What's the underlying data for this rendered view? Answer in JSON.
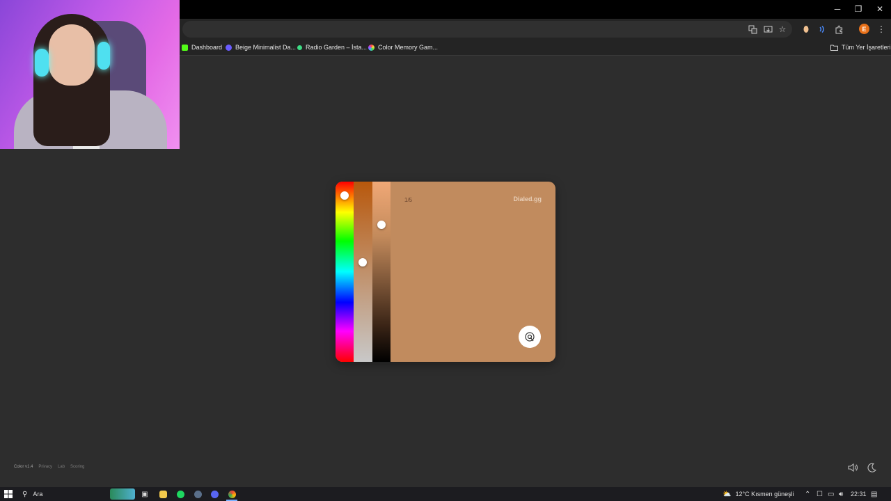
{
  "window": {
    "minimize": "─",
    "restore": "❐",
    "close": "✕"
  },
  "toolbar": {
    "profile_initial": "E",
    "icons": [
      "translate-icon",
      "install-icon",
      "star-icon",
      "extension-icon",
      "radio-extension-icon",
      "puzzle-icon",
      "menu-icon"
    ]
  },
  "bookmarks": {
    "items": [
      {
        "label": "Dashboard",
        "color": "#53fc18"
      },
      {
        "label": "Beige Minimalist Da...",
        "color": "#6a5cff"
      },
      {
        "label": "Radio Garden – İsta...",
        "color": "#3ddc84"
      },
      {
        "label": "Color Memory Gam...",
        "color": "#ff6b9b"
      }
    ],
    "all_bookmarks": "Tüm Yer İşaretleri"
  },
  "game": {
    "round": "1/5",
    "brand": "Dialed.gg",
    "target_color": "#c18b5e",
    "hue_level": 0.07,
    "saturation_level": 0.45,
    "lightness_level": 0.24
  },
  "footer": {
    "version": "Color v1.4",
    "links": [
      "Privacy",
      "Lab",
      "Scoring"
    ]
  },
  "taskbar": {
    "search_placeholder": "Ara",
    "weather": "12°C  Kısmen güneşli",
    "time": "22:31"
  }
}
